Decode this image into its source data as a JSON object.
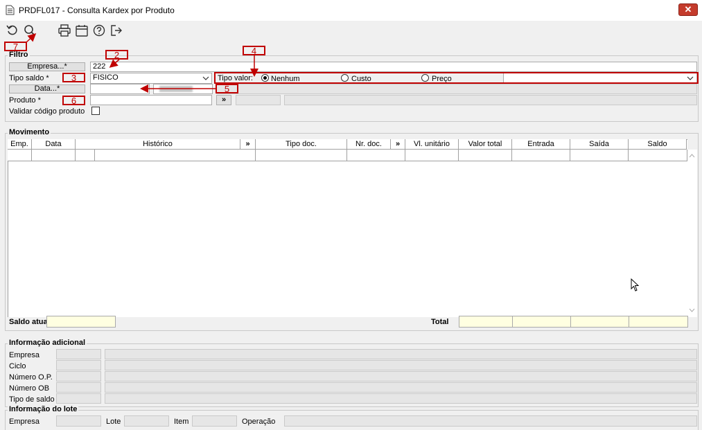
{
  "window": {
    "title": "PRDFL017 - Consulta Kardex por Produto",
    "close_glyph": "✕"
  },
  "toolbar": {
    "icons": [
      "refresh-icon",
      "search-icon",
      "print-icon",
      "calendar-icon",
      "help-icon",
      "exit-icon"
    ]
  },
  "annotations": [
    "7",
    "2",
    "3",
    "4",
    "5",
    "6"
  ],
  "filtro": {
    "group_label": "Filtro",
    "empresa_button": "Empresa...*",
    "empresa_value": "222",
    "tipo_saldo_label": "Tipo saldo *",
    "tipo_saldo_value": "FISICO",
    "tipo_valor_label": "Tipo valor:",
    "tipo_valor_options": [
      "Nenhum",
      "Custo",
      "Preço"
    ],
    "tipo_valor_selected": "Nenhum",
    "data_button": "Data...*",
    "produto_label": "Produto *",
    "produto_more": "»",
    "validar_label": "Validar código produto"
  },
  "movimento": {
    "group_label": "Movimento",
    "columns": [
      "Emp.",
      "Data",
      "Histórico",
      "»",
      "Tipo doc.",
      "Nr. doc.",
      "»",
      "Vl. unitário",
      "Valor total",
      "Entrada",
      "Saída",
      "Saldo"
    ],
    "saldo_atual_label": "Saldo atual",
    "total_label": "Total"
  },
  "info_adicional": {
    "group_label": "Informação adicional",
    "rows": [
      "Empresa",
      "Ciclo",
      "Número O.P.",
      "Número OB",
      "Tipo de saldo"
    ]
  },
  "info_lote": {
    "group_label": "Informação do lote",
    "empresa_label": "Empresa",
    "lote_label": "Lote",
    "item_label": "Item",
    "operacao_label": "Operação"
  },
  "colors": {
    "annotation_red": "#c00000",
    "yellow_field": "#ffffe1",
    "close_red": "#c43b2c"
  }
}
